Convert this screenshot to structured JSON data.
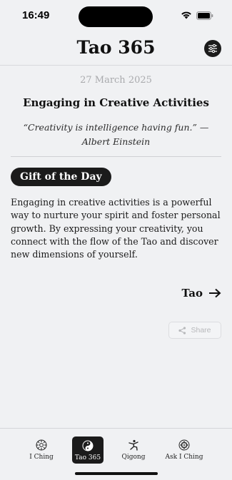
{
  "status_bar": {
    "time": "16:49",
    "wifi_icon": "wifi-icon",
    "battery_icon": "battery-icon"
  },
  "header": {
    "title": "Tao 365",
    "settings_icon": "sliders-icon"
  },
  "entry": {
    "date": "27 March 2025",
    "topic": "Engaging in Creative Activities",
    "quote": "“Creativity is intelligence having fun.” — Albert Einstein",
    "gift_label": "Gift of the Day",
    "body": "Engaging in creative activities is a powerful way to nurture your spirit and foster personal growth. By expressing your creativity, you connect with the flow of the Tao and discover new dimensions of yourself.",
    "tao_link_label": "Tao",
    "share_label": "Share"
  },
  "tab_bar": {
    "tabs": [
      {
        "label": "I Ching",
        "icon": "iching-icon",
        "active": false
      },
      {
        "label": "Tao 365",
        "icon": "yin-yang-icon",
        "active": true
      },
      {
        "label": "Qigong",
        "icon": "qigong-figure-icon",
        "active": false
      },
      {
        "label": "Ask I Ching",
        "icon": "ask-iching-icon",
        "active": false
      }
    ]
  },
  "colors": {
    "background": "#f0f1f3",
    "accent_dark": "#1b1b1b",
    "muted_text": "#a9aaad"
  }
}
